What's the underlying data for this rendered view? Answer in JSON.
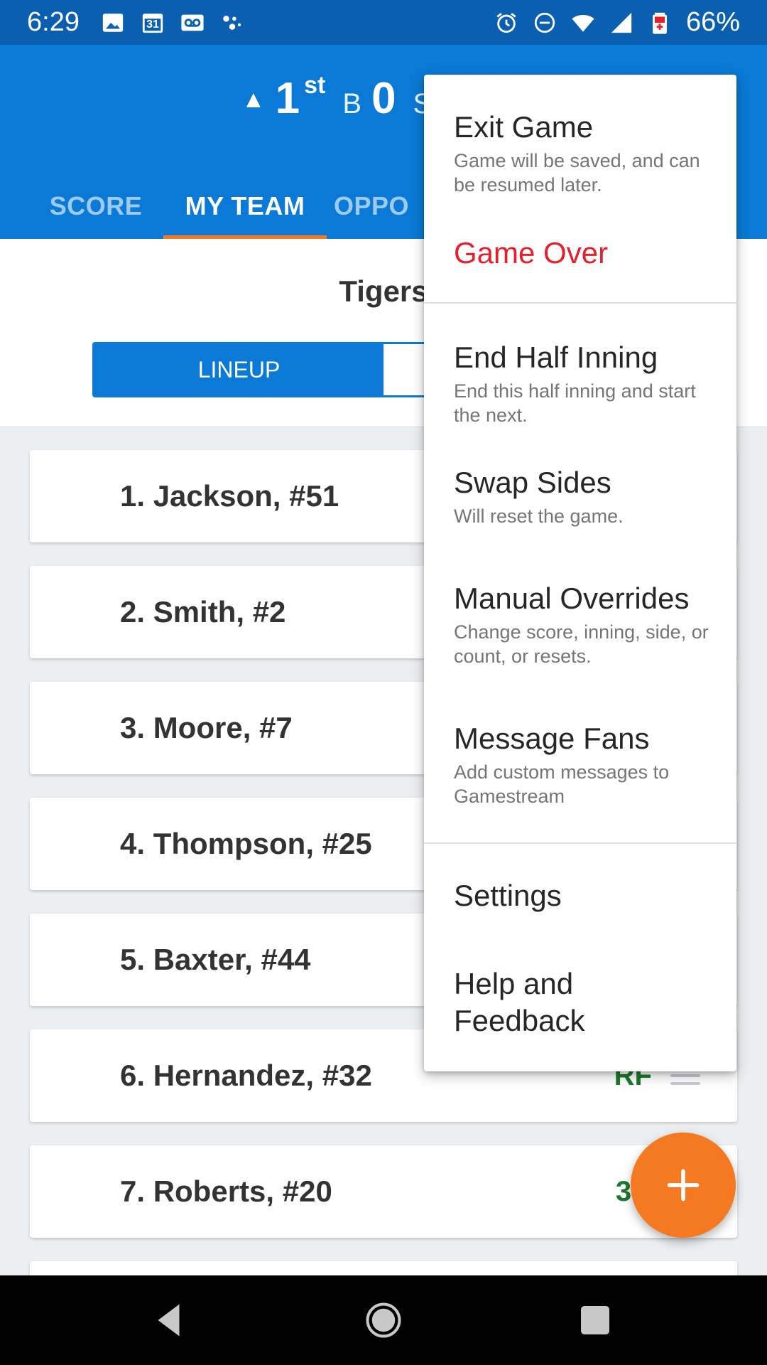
{
  "status_bar": {
    "time": "6:29",
    "calendar_day": "31",
    "battery": "66%",
    "left_icons": [
      "image-icon",
      "calendar-icon",
      "voicemail-icon",
      "assistant-icon"
    ],
    "right_icons": [
      "alarm-icon",
      "do-not-disturb-icon",
      "wifi-icon",
      "signal-icon",
      "battery-icon"
    ]
  },
  "scoreboard": {
    "inning_number": "1",
    "inning_suffix": "st",
    "balls_label": "B",
    "balls_value": "0",
    "strikes_label": "S"
  },
  "tabs": [
    {
      "label": "SCORE",
      "active": false
    },
    {
      "label": "MY TEAM",
      "active": true
    },
    {
      "label": "OPPO",
      "active": false
    }
  ],
  "team": {
    "name": "Tigers",
    "segment_lineup": "LINEUP"
  },
  "lineup": [
    {
      "name": "1. Jackson, #51",
      "position": ""
    },
    {
      "name": "2. Smith, #2",
      "position": ""
    },
    {
      "name": "3. Moore, #7",
      "position": ""
    },
    {
      "name": "4. Thompson, #25",
      "position": ""
    },
    {
      "name": "5. Baxter, #44",
      "position": ""
    },
    {
      "name": "6. Hernandez, #32",
      "position": "RF"
    },
    {
      "name": "7. Roberts, #20",
      "position": "3B"
    }
  ],
  "menu": {
    "exit_game": {
      "title": "Exit Game",
      "desc": "Game will be saved, and can be resumed later."
    },
    "game_over": {
      "title": "Game Over"
    },
    "end_half_inning": {
      "title": "End Half Inning",
      "desc": "End this half inning and start the next."
    },
    "swap_sides": {
      "title": "Swap Sides",
      "desc": "Will reset the game."
    },
    "manual_overrides": {
      "title": "Manual Overrides",
      "desc": "Change score, inning, side, or count, or resets."
    },
    "message_fans": {
      "title": "Message Fans",
      "desc": "Add custom messages to Gamestream"
    },
    "settings": {
      "title": "Settings"
    },
    "help": {
      "title": "Help and Feedback"
    }
  },
  "colors": {
    "app_blue": "#0a7ad6",
    "status_blue": "#0a5fb0",
    "accent_orange": "#f47920",
    "danger_red": "#e5202c",
    "position_green": "#1b7a2d"
  },
  "fab": {
    "icon": "plus-icon"
  }
}
